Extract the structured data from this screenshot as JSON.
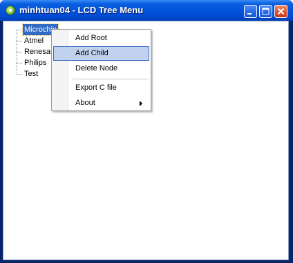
{
  "window": {
    "title": "minhtuan04 - LCD Tree Menu",
    "titlebar_color": "#0355dc",
    "controls": [
      "minimize-icon",
      "maximize-icon",
      "close-icon"
    ]
  },
  "tree": {
    "nodes": [
      {
        "label": "Microchip",
        "selected": true
      },
      {
        "label": "Atmel",
        "selected": false
      },
      {
        "label": "Renesas",
        "selected": false
      },
      {
        "label": "Philips",
        "selected": false
      },
      {
        "label": "Test",
        "selected": false
      }
    ],
    "selection_color": "#316ac5"
  },
  "context_menu": {
    "items": [
      {
        "label": "Add Root",
        "highlighted": false
      },
      {
        "label": "Add Child",
        "highlighted": true
      },
      {
        "label": "Delete Node",
        "highlighted": false
      },
      {
        "label": "Export C file",
        "highlighted": false
      },
      {
        "label": "About",
        "highlighted": false,
        "submenu": true
      }
    ],
    "highlight_color": "#c1d2ee"
  }
}
